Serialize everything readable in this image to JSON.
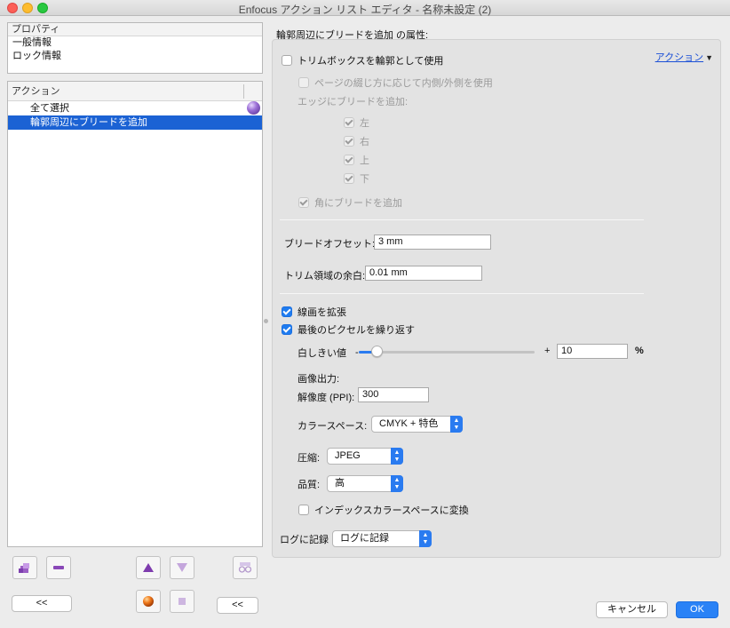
{
  "window": {
    "title": "Enfocus アクション リスト エディタ - 名称未設定 (2)"
  },
  "properties": {
    "header": "プロパティ",
    "items": [
      "一般情報",
      "ロック情報"
    ]
  },
  "actions": {
    "header": "アクション",
    "items": [
      {
        "label": "全て選択",
        "selected": false
      },
      {
        "label": "輪郭周辺にブリードを追加",
        "selected": true
      }
    ]
  },
  "left_buttons": {
    "collapse_left": "<<",
    "collapse_right": "<<"
  },
  "detail": {
    "title": "輪郭周辺にブリードを追加 の属性:",
    "action_link": "アクション",
    "trim_as_outline": {
      "label": "トリムボックスを輪郭として使用",
      "checked": false
    },
    "binding_side": {
      "label": "ページの綴じ方に応じて内側/外側を使用",
      "checked": false
    },
    "edges_label": "エッジにブリードを追加:",
    "edges": [
      {
        "label": "左",
        "checked": true
      },
      {
        "label": "右",
        "checked": true
      },
      {
        "label": "上",
        "checked": true
      },
      {
        "label": "下",
        "checked": true
      }
    ],
    "corners": {
      "label": "角にブリードを追加",
      "checked": true
    },
    "bleed_offset": {
      "label": "ブリードオフセット:",
      "value": "3 mm"
    },
    "trim_margin": {
      "label": "トリム領域の余白:",
      "value": "0.01 mm"
    },
    "expand_lineart": {
      "label": "線画を拡張",
      "checked": true
    },
    "repeat_pixels": {
      "label": "最後のピクセルを繰り返す",
      "checked": true
    },
    "threshold": {
      "label": "白しきい値",
      "minus": "-",
      "plus": "+",
      "value": "10",
      "unit": "%",
      "level": 0.1
    },
    "image_output_label": "画像出力:",
    "resolution": {
      "label": "解像度 (PPI):",
      "value": "300"
    },
    "colorspace": {
      "label": "カラースペース:",
      "value": "CMYK + 特色"
    },
    "compression": {
      "label": "圧縮:",
      "value": "JPEG"
    },
    "quality": {
      "label": "品質:",
      "value": "高"
    },
    "index_convert": {
      "label": "インデックスカラースペースに変換",
      "checked": false
    },
    "log": {
      "label": "ログに記録",
      "value": "ログに記録"
    }
  },
  "footer": {
    "cancel": "キャンセル",
    "ok": "OK"
  },
  "colors": {
    "accent": "#2a7bf0",
    "selection": "#1b62d4"
  }
}
